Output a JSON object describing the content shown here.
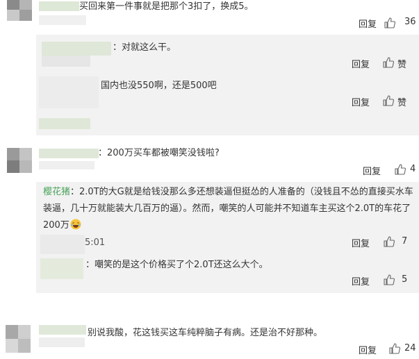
{
  "comments": [
    {
      "text": "买回来第一件事就是把那个3扣了，换成5。",
      "reply": "回复",
      "likes": "36"
    },
    {
      "text": "对就这么干。",
      "reply": "回复",
      "likes": "赞"
    },
    {
      "text": "国内也没550啊，还是500吧",
      "reply": "回复",
      "likes": "赞"
    },
    {
      "text": "200万买车都被嘲笑没钱啦?",
      "reply": "回复",
      "likes": "4"
    },
    {
      "author": "樱花猪",
      "line1": "2.0T的大G就是给钱没那么多还想装逼但挺怂的人准备的（没钱且不怂的直接买水车",
      "line2": "装逼，几十万就能装大几百万的逼）。然而，嘲笑的人可能并不知道车主买这个2.0T的车花了",
      "line3": "200万",
      "time": "5:01",
      "reply": "回复",
      "likes": "7"
    },
    {
      "text": "嘲笑的是这个价格买了个2.0T还这么大个。",
      "reply": "回复",
      "likes": "5"
    },
    {
      "text": "别说我酸，花这钱买这车纯粹脑子有病。还是治不好那种。",
      "reply": "回复",
      "likes": "24"
    }
  ],
  "colors": {
    "author": "#49a35a",
    "subbox": "#f2f2f2",
    "text": "#333333"
  },
  "icons": {
    "like": "thumb-up-icon",
    "emoji": "laughing-emoji-icon"
  }
}
